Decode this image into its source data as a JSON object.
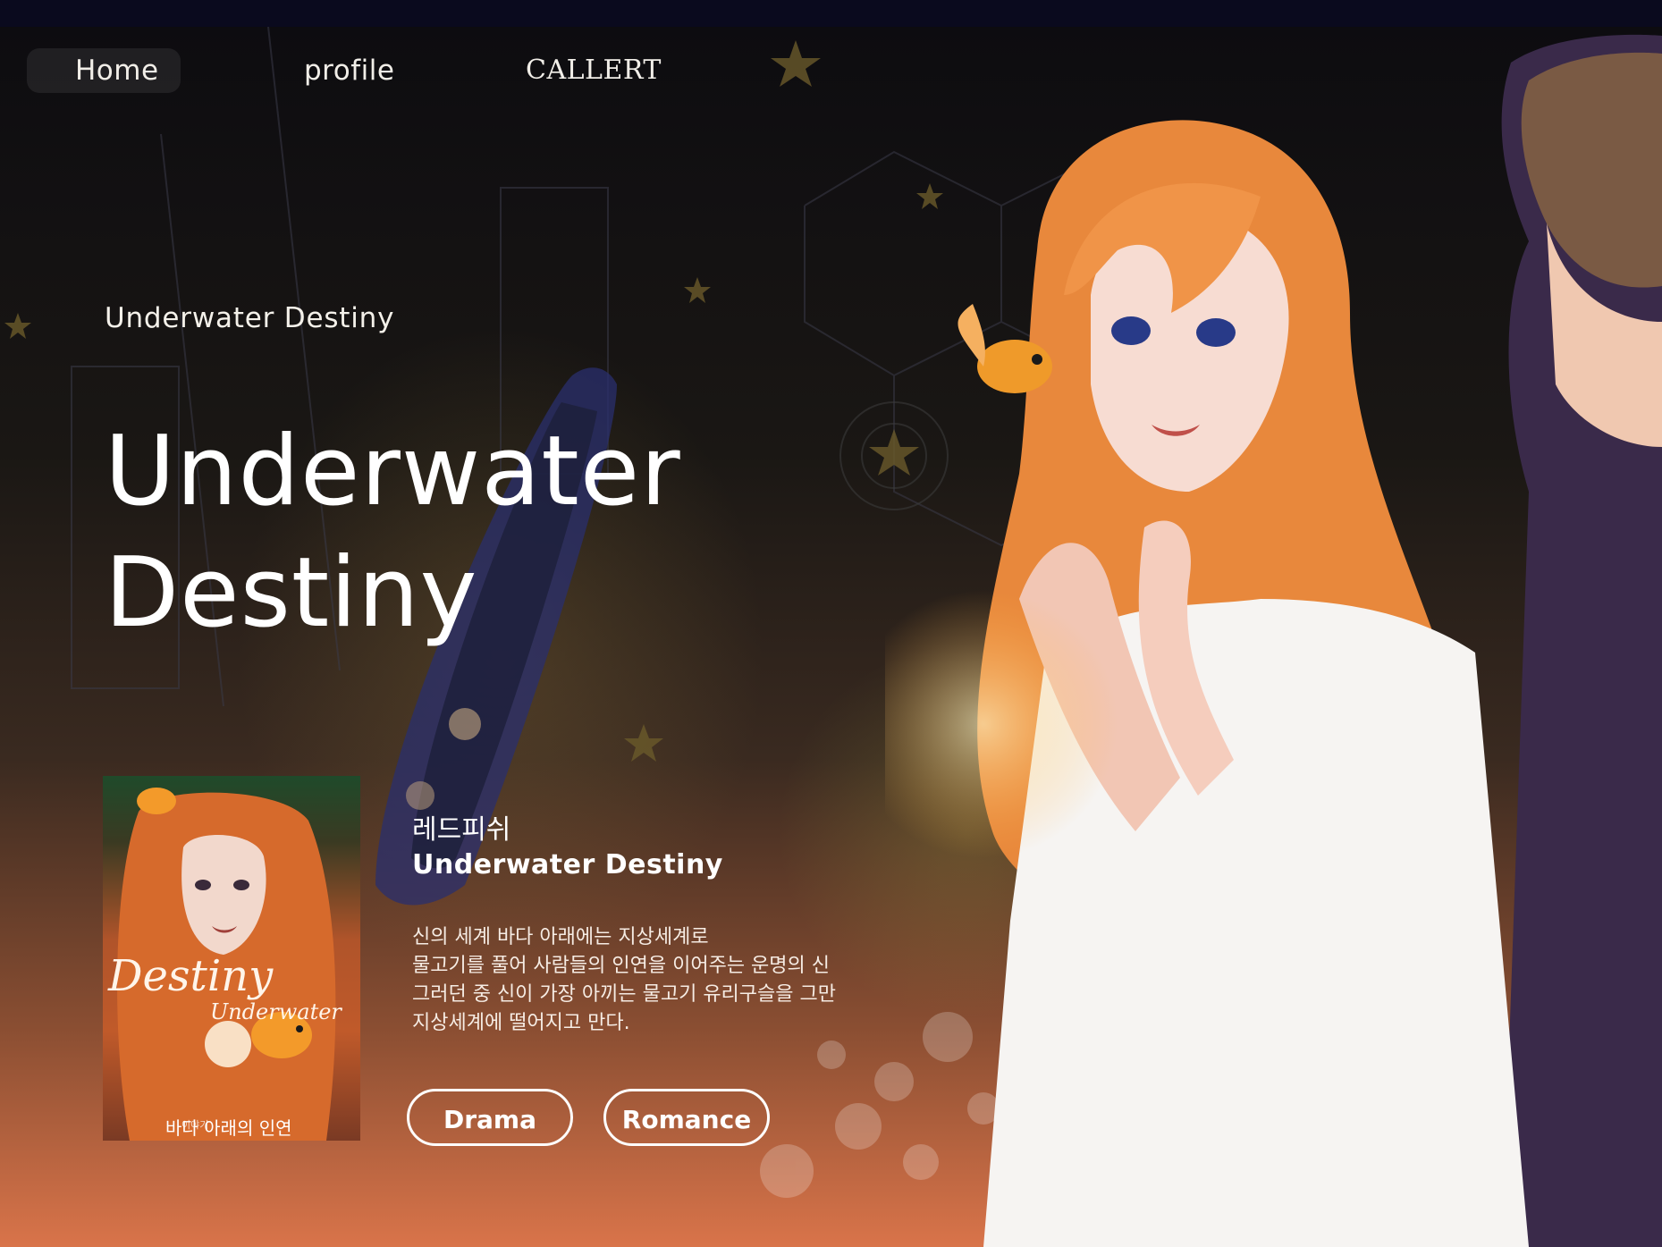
{
  "nav": {
    "items": [
      {
        "label": "Home"
      },
      {
        "label": "profile"
      },
      {
        "label": "CALLERT"
      }
    ]
  },
  "hero": {
    "kicker": "Underwater Destiny",
    "title_line1": "Underwater",
    "title_line2": "Destiny"
  },
  "book": {
    "cover": {
      "title_main": "Destiny",
      "title_sub": "Underwater",
      "tagline": "이야기",
      "korean_title": "바다 아래의 인연"
    },
    "author": "레드피쉬",
    "title": "Underwater Destiny",
    "description": [
      "신의 세계 바다 아래에는 지상세계로",
      "물고기를 풀어 사람들의 인연을 이어주는 운명의 신",
      "그러던 중 신이 가장 아끼는 물고기 유리구슬을 그만",
      "지상세계에 떨어지고 만다."
    ]
  },
  "tags": [
    {
      "label": "Drama"
    },
    {
      "label": "Romance"
    }
  ],
  "colors": {
    "accent_orange": "#e8883c",
    "text": "#ffffff",
    "top_bar": "#0a0a1e"
  },
  "icons": {
    "background": "night-city-illustration",
    "character": "orange-haired-girl-illustration",
    "fish": "goldfish-icon"
  }
}
